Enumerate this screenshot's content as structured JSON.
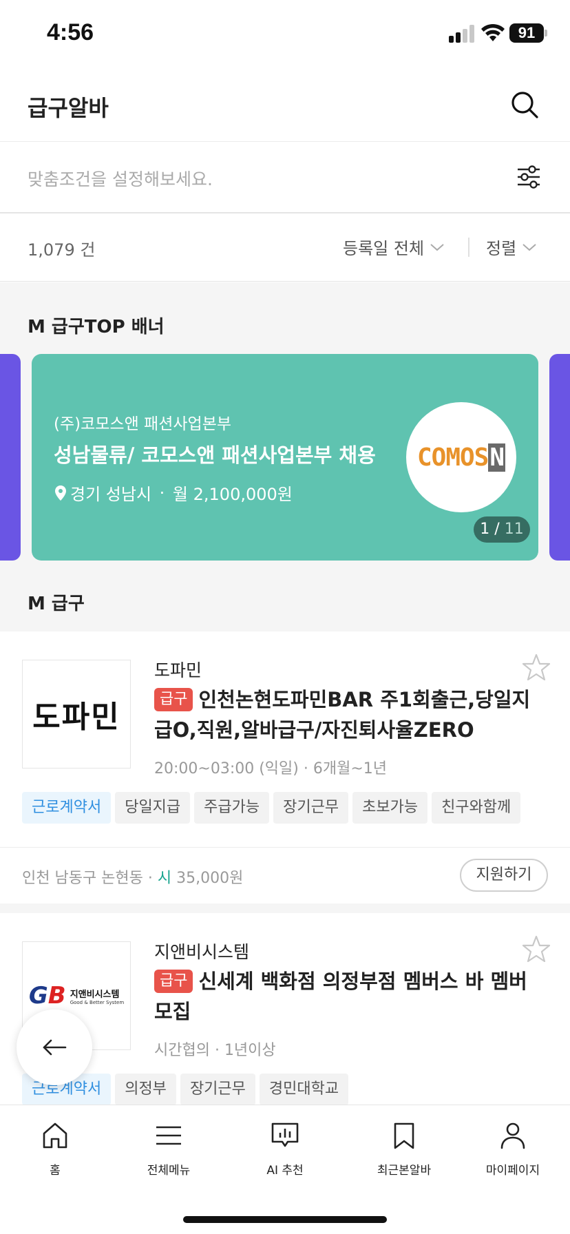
{
  "status_bar": {
    "time": "4:56",
    "battery": "91"
  },
  "header": {
    "title": "급구알바"
  },
  "filter": {
    "placeholder": "맞춤조건을 설정해보세요."
  },
  "list_info": {
    "count": "1,079 건",
    "date_filter": "등록일 전체",
    "sort": "정렬"
  },
  "banner_section": {
    "title": "M 급구TOP 배너",
    "banner": {
      "company": "(주)코모스앤 패션사업본부",
      "title": "성남물류/ 코모스앤 패션사업본부 채용",
      "location": "경기 성남시",
      "separator": " · ",
      "pay": "월 2,100,000원",
      "logo_text": "COMOS",
      "logo_mark": "N",
      "page_current": "1",
      "page_separator": " / ",
      "page_total": "11"
    }
  },
  "jobs_section": {
    "title": "M 급구"
  },
  "jobs": [
    {
      "company": "도파민",
      "logo_text": "도파민",
      "badge": "급구",
      "title": "인천논현도파민BAR 주1회출근,당일지급O,직원,알바급구/자진퇴사율ZERO",
      "schedule": "20:00~03:00 (익일) · 6개월~1년",
      "tags": [
        "근로계약서",
        "당일지급",
        "주급가능",
        "장기근무",
        "초보가능",
        "친구와함께"
      ],
      "location": "인천 남동구 논현동 · ",
      "pay_type": "시",
      "pay": " 35,000원",
      "apply_label": "지원하기"
    },
    {
      "company": "지앤비시스템",
      "logo_ko": "지앤비시스템",
      "logo_en": "Good & Better System",
      "badge": "급구",
      "title": "신세계 백화점 의정부점 멤버스 바 멤버 모집",
      "schedule": "시간협의 · 1년이상",
      "tags": [
        "근로계약서",
        "의정부",
        "장기근무",
        "경민대학교"
      ]
    }
  ],
  "bottom_nav": [
    {
      "label": "홈",
      "icon": "home-icon"
    },
    {
      "label": "전체메뉴",
      "icon": "menu-icon"
    },
    {
      "label": "AI 추천",
      "icon": "ai-chart-icon"
    },
    {
      "label": "최근본알바",
      "icon": "bookmark-icon"
    },
    {
      "label": "마이페이지",
      "icon": "person-icon"
    }
  ],
  "colors": {
    "accent_teal": "#5fc3b0",
    "banner_side": "#6a55e4",
    "urgent_red": "#e8534a",
    "tag_blue": "#2f8fe0",
    "pay_green": "#17a48e"
  }
}
